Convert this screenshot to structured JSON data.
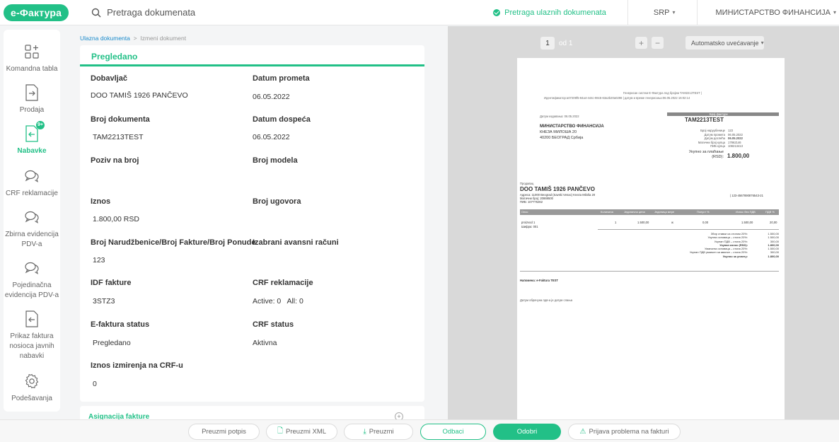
{
  "app": {
    "logo": "е-Фактура",
    "search_placeholder": "Pretraga dokumenata",
    "incoming_search": "Pretraga ulaznih dokumenata",
    "language": "SRP",
    "organization": "МИНИСТАРСТВО ФИНАНСИЈА"
  },
  "sidebar": {
    "items": [
      {
        "label": "Komandna tabla"
      },
      {
        "label": "Prodaja"
      },
      {
        "label": "Nabavke",
        "badge": "9+"
      },
      {
        "label": "CRF reklamacije"
      },
      {
        "label": "Zbirna evidencija PDV-a"
      },
      {
        "label": "Pojedinačna evidencija PDV-a"
      },
      {
        "label": "Prikaz faktura nosioca javnih nabavki"
      },
      {
        "label": "Podešavanja"
      }
    ]
  },
  "breadcrumb": {
    "parent": "Ulazna dokumenta",
    "separator": ">",
    "current": "Izmeni dokument"
  },
  "document": {
    "status": "Pregledano",
    "fields": {
      "supplier_label": "Dobavljač",
      "supplier": "DOO TAMIŠ 1926 PANČEVO",
      "delivery_date_label": "Datum prometa",
      "delivery_date": "06.05.2022",
      "doc_number_label": "Broj dokumenta",
      "doc_number": "TAM2213TEST",
      "due_date_label": "Datum dospeća",
      "due_date": "06.05.2022",
      "reference_label": "Poziv na broj",
      "model_label": "Broj modela",
      "amount_label": "Iznos",
      "amount": "1.800,00 RSD",
      "contract_label": "Broj ugovora",
      "order_label": "Broj Narudžbenice/Broj Fakture/Broj Ponude",
      "order": "123",
      "advance_label": "Izabrani avansni računi",
      "idf_label": "IDF fakture",
      "idf": "3STZ3",
      "crf_claims_label": "CRF reklamacije",
      "crf_claims": "Active: 0   All: 0",
      "efaktura_status_label": "E-faktura status",
      "efaktura_status": "Pregledano",
      "crf_status_label": "CRF status",
      "crf_status": "Aktivna",
      "crf_settlement_label": "Iznos izmirenja na CRF-u",
      "crf_settlement": "0"
    },
    "next_section": "Asignacija fakture"
  },
  "viewer": {
    "page": "1",
    "of_pages": "od 1",
    "zoom_in": "+",
    "zoom_out": "−",
    "zoom_mode": "Automatsko uvećavanje"
  },
  "invoice": {
    "header_line1": "Генерисан систем Е-Фактура под бројем TAM2213TEST |",
    "header_line2": "Идентификатор:a07209f5-84a4-444c-98c5-63a2b20a0298 | датум и време генерисања:06.05.2022 16:02:14",
    "issue_date": "Датум издавања: 06.05.2022",
    "buyer_name": "МИНИСТАРСТВО ФИНАНСИЈА",
    "buyer_street": "КНЕЗА МИЛОША 20",
    "buyer_city": "40200 БЕОГРАД Србија",
    "invoice_no_label": "Број фактуре",
    "invoice_no": "TAM2213TEST",
    "meta_labels": [
      "Број наруџбенице",
      "Датум промета",
      "Датум доспећа",
      "Матични број купца",
      "ПИБ купца"
    ],
    "meta_values": [
      "123",
      "06.05.2022",
      "06.05.2022",
      "17862146",
      "108213413"
    ],
    "total_label": "Укупно за плаћање (RSD):",
    "total": "1.800,00",
    "seller_caption": "Продавац",
    "seller_name": "DOO TAMIŠ 1926 PANČEVO",
    "seller_address": "Адреса: 11000 Beograd (Savski Venac) Kneza Miloša 20",
    "seller_mb": "Матични број: 20869500",
    "seller_pib": "ПИБ: 107775262",
    "seller_account": "| 123-4567890876543-21",
    "table_headers": [
      "Опис",
      "Количина",
      "Јединична цена",
      "Јединица мере",
      "Попуст %",
      "Износ без ПДВ",
      "ПДВ %"
    ],
    "row": [
      "proizvod 1",
      "1",
      "1.500,00",
      "ж",
      "0,00",
      "1.500,00",
      "20,00"
    ],
    "row_code": "Шифра: 001",
    "summary_labels": [
      "Збир ставки са стопом 20%:",
      "Укупна основица – стопа 20%:",
      "Укупан ПДВ – стопа 20%:",
      "Укупан износ (RSD):",
      "Умањена основица – стопа 20%:",
      "Укупан ПДВ умањен за авансе – стопа 20%:",
      "Укупно за уплату:"
    ],
    "summary_values": [
      "1.500,00",
      "1.500,00",
      "300,00",
      "1.800,00",
      "1.500,00",
      "300,00",
      "1.800,00"
    ],
    "note": "Напомена: e-Faktura TEST",
    "vat_note": "Датум обрачуна пдв-а је датум слања"
  },
  "actions": {
    "download_signature": "Preuzmi potpis",
    "download_xml": "Preuzmi XML",
    "download": "Preuzmi",
    "reject": "Odbaci",
    "approve": "Odobri",
    "report_problem": "Prijava problema na fakturi"
  },
  "colors": {
    "accent": "#22c087",
    "link": "#1a8acb"
  }
}
